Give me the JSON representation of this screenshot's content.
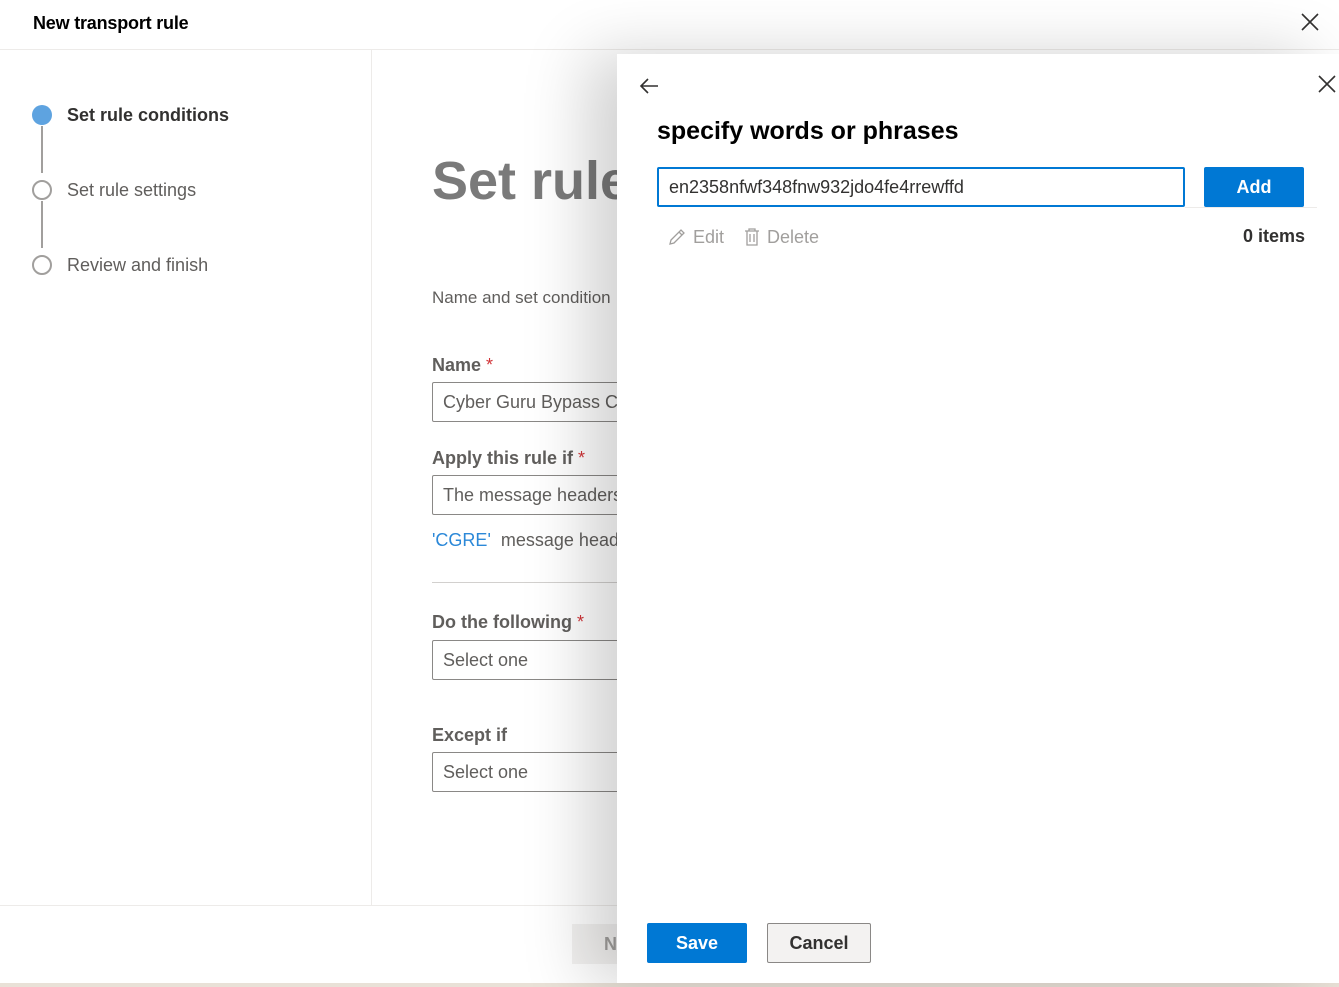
{
  "header": {
    "title": "New transport rule",
    "close_icon": "close-icon"
  },
  "steps": [
    {
      "label": "Set rule conditions",
      "state": "active"
    },
    {
      "label": "Set rule settings",
      "state": "todo"
    },
    {
      "label": "Review and finish",
      "state": "todo"
    }
  ],
  "main": {
    "heading": "Set rule",
    "description": "Name and set condition",
    "name_label": "Name",
    "name_value": "Cyber Guru Bypass Clu",
    "apply_label": "Apply this rule if",
    "apply_value": "The message headers..",
    "condition_link": "'CGRE'",
    "condition_text": "message heade",
    "do_label": "Do the following",
    "do_value": "Select one",
    "except_label": "Except if",
    "except_value": "Select one",
    "required_mark": "*"
  },
  "footer": {
    "next_label": "N"
  },
  "panel": {
    "title": "specify words or phrases",
    "input_value": "en2358nfwf348fnw932jdo4fe4rrewffd",
    "add_label": "Add",
    "edit_label": "Edit",
    "delete_label": "Delete",
    "items_count": "0 items",
    "save_label": "Save",
    "cancel_label": "Cancel"
  },
  "colors": {
    "accent": "#0078d4",
    "step_active": "#5ea3e0",
    "required": "#d13438",
    "link": "#2b88d8"
  }
}
